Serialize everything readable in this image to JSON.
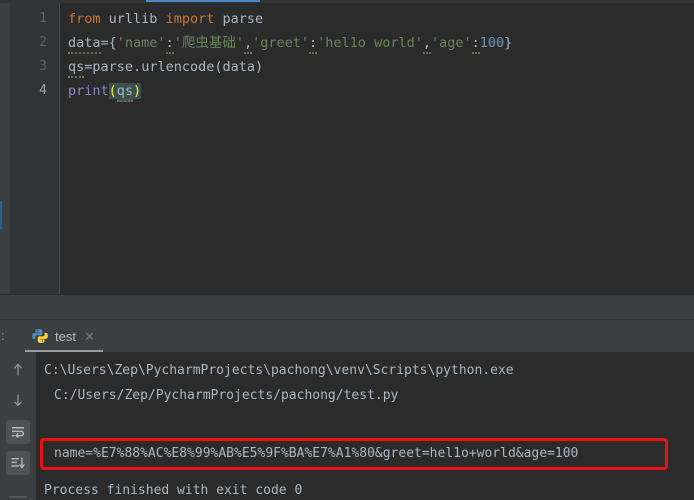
{
  "window": {
    "theme": "darcula",
    "bg_editor": "#2b2b2b",
    "bg_chrome": "#3c3f41",
    "accent_blue": "#4a88c7",
    "highlight_red": "#ee1111"
  },
  "editor": {
    "line_numbers": [
      "1",
      "2",
      "3",
      "4"
    ],
    "current_line": 4,
    "lines": [
      {
        "number": "1",
        "tokens": [
          {
            "text": "from",
            "type": "keyword"
          },
          {
            "text": " ",
            "type": "plain"
          },
          {
            "text": "urllib",
            "type": "identifier"
          },
          {
            "text": " ",
            "type": "plain"
          },
          {
            "text": "import",
            "type": "keyword"
          },
          {
            "text": " ",
            "type": "plain"
          },
          {
            "text": "parse",
            "type": "identifier"
          }
        ],
        "plain": "from urllib import parse"
      },
      {
        "number": "2",
        "tokens": [
          {
            "text": "data",
            "type": "identifier"
          },
          {
            "text": "=",
            "type": "operator"
          },
          {
            "text": "{",
            "type": "brace"
          },
          {
            "text": "'name'",
            "type": "string"
          },
          {
            "text": ":",
            "type": "operator"
          },
          {
            "text": "'爬虫基础'",
            "type": "string"
          },
          {
            "text": ",",
            "type": "operator"
          },
          {
            "text": "'greet'",
            "type": "string"
          },
          {
            "text": ":",
            "type": "operator"
          },
          {
            "text": "'hel1o world'",
            "type": "string"
          },
          {
            "text": ",",
            "type": "operator"
          },
          {
            "text": "'age'",
            "type": "string"
          },
          {
            "text": ":",
            "type": "operator"
          },
          {
            "text": "100",
            "type": "number"
          },
          {
            "text": "}",
            "type": "brace"
          }
        ],
        "plain": "data={'name':'爬虫基础','greet':'hel1o world','age':100}"
      },
      {
        "number": "3",
        "tokens": [
          {
            "text": "qs",
            "type": "identifier"
          },
          {
            "text": "=",
            "type": "operator"
          },
          {
            "text": "parse",
            "type": "identifier"
          },
          {
            "text": ".",
            "type": "operator"
          },
          {
            "text": "urlencode",
            "type": "function"
          },
          {
            "text": "(",
            "type": "brace"
          },
          {
            "text": "data",
            "type": "identifier"
          },
          {
            "text": ")",
            "type": "brace"
          }
        ],
        "plain": "qs=parse.urlencode(data)"
      },
      {
        "number": "4",
        "tokens": [
          {
            "text": "print",
            "type": "builtin"
          },
          {
            "text": "(",
            "type": "brace-highlight"
          },
          {
            "text": "qs",
            "type": "identifier-highlight"
          },
          {
            "text": ")",
            "type": "brace-highlight"
          }
        ],
        "plain": "print(qs)"
      }
    ],
    "code_l1_kw1": "from",
    "code_l1_mod": "urllib",
    "code_l1_kw2": "import",
    "code_l1_name": "parse",
    "code_l2_var": "data",
    "code_l2_eq": "=",
    "code_l2_open": "{",
    "code_l2_k1": "'name'",
    "code_l2_c1": ":",
    "code_l2_v1": "'爬虫基础'",
    "code_l2_comma1": ",",
    "code_l2_k2": "'greet'",
    "code_l2_c2": ":",
    "code_l2_v2": "'hel1o world'",
    "code_l2_comma2": ",",
    "code_l2_k3": "'age'",
    "code_l2_c3": ":",
    "code_l2_v3": "100",
    "code_l2_close": "}",
    "code_l3_var": "qs",
    "code_l3_eq": "=",
    "code_l3_mod": "parse",
    "code_l3_dot": ".",
    "code_l3_fn": "urlencode",
    "code_l3_p1": "(",
    "code_l3_arg": "data",
    "code_l3_p2": ")",
    "code_l4_fn": "print",
    "code_l4_p1": "(",
    "code_l4_arg": "qs",
    "code_l4_p2": ")"
  },
  "run_panel": {
    "tab": {
      "label": "test",
      "close_label": "✕",
      "icon": "python-icon"
    },
    "left_label": ":",
    "toolbar": [
      {
        "name": "scroll-up-button",
        "icon": "arrow-up-icon",
        "glyph": "↑"
      },
      {
        "name": "scroll-down-button",
        "icon": "arrow-down-icon",
        "glyph": "↓"
      },
      {
        "name": "soft-wrap-button",
        "icon": "soft-wrap-icon",
        "glyph": "⤶"
      },
      {
        "name": "scroll-to-end-button",
        "icon": "scroll-to-end-icon",
        "glyph": "⤓"
      }
    ],
    "output": {
      "line1": "C:\\Users\\Zep\\PycharmProjects\\pachong\\venv\\Scripts\\python.exe",
      "line2": "C:/Users/Zep/PycharmProjects/pachong/test.py",
      "line3_highlighted": "name=%E7%88%AC%E8%99%AB%E5%9F%BA%E7%A1%80&greet=hel1o+world&age=100",
      "line4": "Process finished with exit code 0"
    }
  }
}
